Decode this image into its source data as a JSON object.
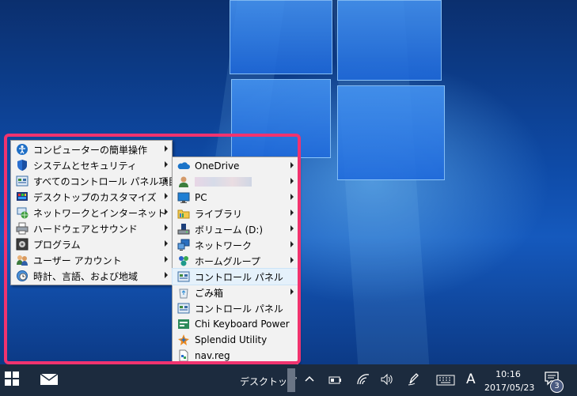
{
  "menu_main": {
    "items": [
      {
        "label": "コンピューターの簡単操作",
        "icon": "accessibility-icon"
      },
      {
        "label": "システムとセキュリティ",
        "icon": "shield-icon"
      },
      {
        "label": "すべてのコントロール パネル項目",
        "icon": "control-panel-icon"
      },
      {
        "label": "デスクトップのカスタマイズ",
        "icon": "personalize-icon"
      },
      {
        "label": "ネットワークとインターネット",
        "icon": "network-globe-icon"
      },
      {
        "label": "ハードウェアとサウンド",
        "icon": "printer-icon"
      },
      {
        "label": "プログラム",
        "icon": "programs-icon"
      },
      {
        "label": "ユーザー アカウント",
        "icon": "users-icon"
      },
      {
        "label": "時計、言語、および地域",
        "icon": "clock-globe-icon"
      }
    ]
  },
  "menu_sub": {
    "items": [
      {
        "label": "OneDrive",
        "icon": "cloud-icon",
        "submenu": true
      },
      {
        "label": "",
        "icon": "user-icon",
        "submenu": true,
        "blurred": true
      },
      {
        "label": "PC",
        "icon": "monitor-icon",
        "submenu": true
      },
      {
        "label": "ライブラリ",
        "icon": "library-icon",
        "submenu": true
      },
      {
        "label": "ボリューム (D:)",
        "icon": "drive-icon",
        "submenu": true
      },
      {
        "label": "ネットワーク",
        "icon": "network-icon",
        "submenu": true
      },
      {
        "label": "ホームグループ",
        "icon": "homegroup-icon",
        "submenu": true
      },
      {
        "label": "コントロール パネル",
        "icon": "control-panel-icon",
        "submenu": false,
        "highlighted": true
      },
      {
        "label": "ごみ箱",
        "icon": "recycle-bin-icon",
        "submenu": true
      },
      {
        "label": "コントロール パネル",
        "icon": "control-panel-icon",
        "submenu": false
      },
      {
        "label": "Chi Keyboard Power",
        "icon": "keyboard-app-icon",
        "submenu": false
      },
      {
        "label": "Splendid Utility",
        "icon": "splendid-icon",
        "submenu": false
      },
      {
        "label": "nav.reg",
        "icon": "reg-file-icon",
        "submenu": false
      }
    ]
  },
  "taskbar": {
    "toolbar_label": "デスクトップ",
    "ime_label": "A",
    "time": "10:16",
    "date": "2017/05/23",
    "notification_count": "3"
  },
  "colors": {
    "highlight_frame": "#f0336f",
    "taskbar": "#1c2b3e",
    "menu_bg": "#f2f2f2",
    "hover": "#e5f1fb"
  }
}
